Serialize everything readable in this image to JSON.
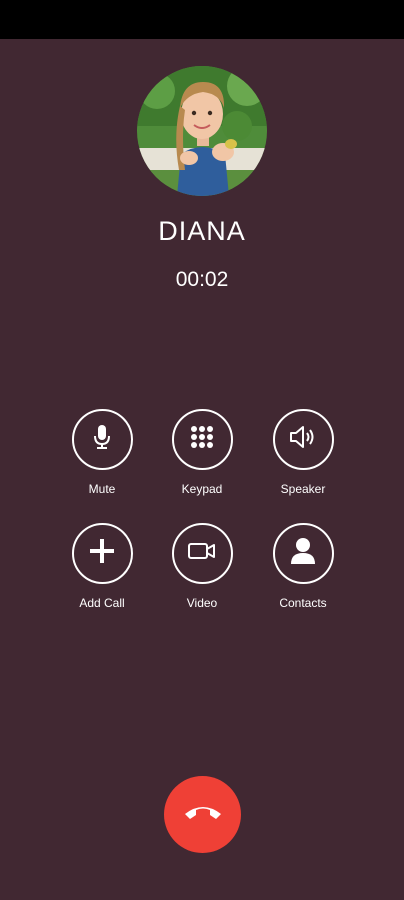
{
  "caller": {
    "name": "DIANA",
    "timer": "00:02"
  },
  "controls": [
    {
      "label": "Mute",
      "icon": "microphone-icon"
    },
    {
      "label": "Keypad",
      "icon": "keypad-icon"
    },
    {
      "label": "Speaker",
      "icon": "speaker-icon"
    },
    {
      "label": "Add Call",
      "icon": "plus-icon"
    },
    {
      "label": "Video",
      "icon": "video-camera-icon"
    },
    {
      "label": "Contacts",
      "icon": "person-icon"
    }
  ],
  "end_call": {
    "icon": "phone-hangup-icon"
  },
  "colors": {
    "background": "#412832",
    "status_bar": "#000000",
    "end_call": "#ef4036",
    "foreground": "#ffffff"
  }
}
